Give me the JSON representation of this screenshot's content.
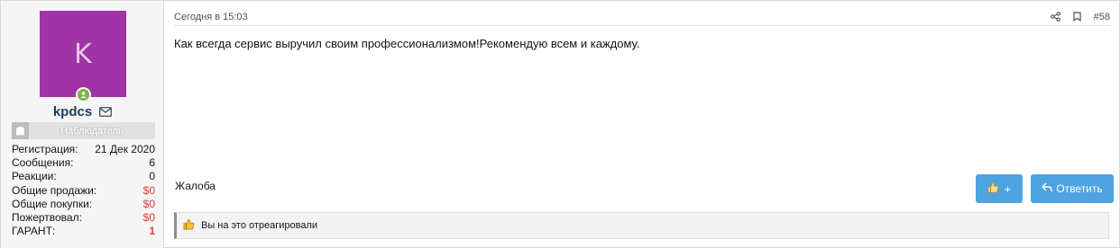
{
  "user": {
    "avatar_letter": "K",
    "avatar_color": "#a033a6",
    "online_color": "#7cb342",
    "username": "kpdcs",
    "role": "Наблюдатель",
    "stats": [
      {
        "label": "Регистрация:",
        "value": "21 Дек 2020",
        "style": "normal"
      },
      {
        "label": "Сообщения:",
        "value": "6",
        "style": "normal"
      },
      {
        "label": "Реакции:",
        "value": "0",
        "style": "normal"
      },
      {
        "label": "Общие продажи:",
        "value": "$0",
        "style": "red"
      },
      {
        "label": "Общие покупки:",
        "value": "$0",
        "style": "red"
      },
      {
        "label": "Пожертвовал:",
        "value": "$0",
        "style": "red"
      },
      {
        "label": "ГАРАНТ:",
        "value": "1",
        "style": "red-bold"
      }
    ]
  },
  "post": {
    "date": "Сегодня в 15:03",
    "number": "#58",
    "message": "Как всегда сервис выручил своим профессионализмом!Рекомендую всем и каждому.",
    "report_label": "Жалоба",
    "like_label": "+",
    "reply_label": "Ответить",
    "reactions_text": "Вы на это отреагировали",
    "accent_color": "#4fa3e0"
  }
}
